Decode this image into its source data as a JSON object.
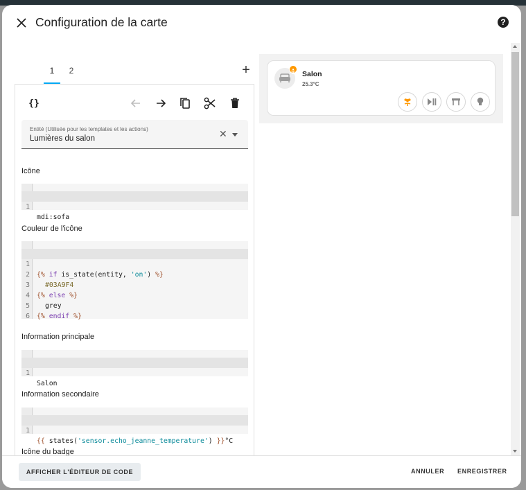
{
  "dialog": {
    "title": "Configuration de la carte"
  },
  "editor": {
    "tabs": [
      {
        "label": "1"
      },
      {
        "label": "2"
      }
    ],
    "toolbar": {
      "code_label": "{}"
    },
    "entity_field": {
      "label": "Entité (Utilisée pour les templates et les actions)",
      "value": "Lumières du salon"
    },
    "fields": {
      "icon": {
        "label": "Icône",
        "line_numbers": [
          "1"
        ],
        "code": "mdi:sofa"
      },
      "icon_color": {
        "label": "Couleur de l'icône",
        "line_numbers": [
          "1",
          "2",
          "3",
          "4",
          "5",
          "6"
        ],
        "lines": {
          "l1": {
            "open": "{%",
            "kw": "if",
            "expr": "is_state(entity,",
            "str": "'on'",
            "rest": ")",
            "close": "%}"
          },
          "l2": {
            "text": "#03A9F4"
          },
          "l3": {
            "open": "{%",
            "kw": "else",
            "close": "%}"
          },
          "l4": {
            "text": "grey"
          },
          "l5": {
            "open": "{%",
            "kw": "endif",
            "close": "%}"
          }
        }
      },
      "primary": {
        "label": "Information principale",
        "line_numbers": [
          "1"
        ],
        "code": "Salon"
      },
      "secondary": {
        "label": "Information secondaire",
        "line_numbers": [
          "1"
        ],
        "code": {
          "open": "{{",
          "func": "states(",
          "str": "'sensor.echo_jeanne_temperature'",
          "rest": ")",
          "close": "}}",
          "suffix": "°C"
        }
      },
      "badge_icon": {
        "label": "Icône du badge"
      }
    }
  },
  "preview": {
    "card": {
      "name": "Salon",
      "state": "25.3°C",
      "icon": "sofa-icon",
      "badge_color": "#ff9800",
      "chips": [
        "flower-icon",
        "play-pause-icon",
        "table-icon",
        "lightbulb-icon"
      ],
      "chip_accent": "#ff9800"
    }
  },
  "footer": {
    "code_editor_label": "AFFICHER L'ÉDITEUR DE CODE",
    "cancel_label": "ANNULER",
    "save_label": "ENREGISTRER"
  },
  "colors": {
    "accent": "#03a9f4",
    "badge": "#ff9800"
  }
}
